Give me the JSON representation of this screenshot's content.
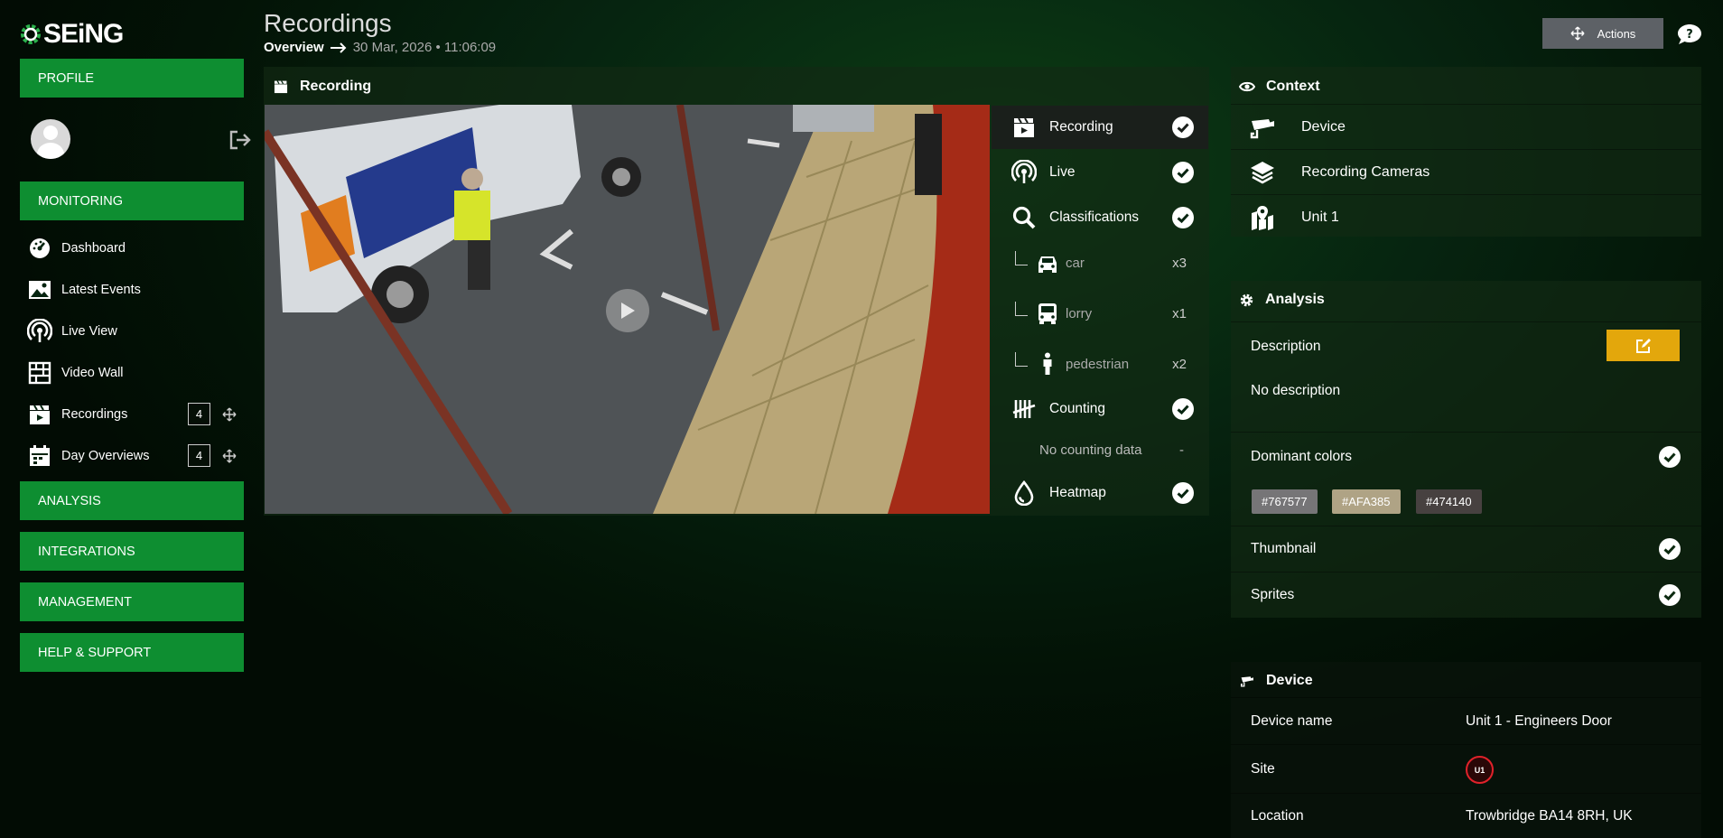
{
  "brand": {
    "logo_text": "SEiNG"
  },
  "sidebar": {
    "sections": {
      "profile": "PROFILE",
      "monitoring": "MONITORING",
      "analysis": "ANALYSIS",
      "integrations": "INTEGRATIONS",
      "management": "MANAGEMENT",
      "help": "HELP & SUPPORT"
    },
    "monitoring_items": [
      {
        "label": "Dashboard",
        "icon": "dashboard-icon"
      },
      {
        "label": "Latest Events",
        "icon": "image-icon"
      },
      {
        "label": "Live View",
        "icon": "live-icon"
      },
      {
        "label": "Video Wall",
        "icon": "video-wall-icon"
      },
      {
        "label": "Recordings",
        "icon": "clapperboard-icon",
        "count": "4"
      },
      {
        "label": "Day Overviews",
        "icon": "calendar-icon",
        "count": "4"
      }
    ]
  },
  "header": {
    "title": "Recordings",
    "breadcrumb_root": "Overview",
    "breadcrumb_date": "30 Mar, 2026 • 11:06:09",
    "actions_label": "Actions"
  },
  "recording_panel": {
    "title": "Recording",
    "features": [
      {
        "label": "Recording",
        "checked": true
      },
      {
        "label": "Live",
        "checked": true
      },
      {
        "label": "Classifications",
        "checked": true
      },
      {
        "label": "Counting",
        "checked": true
      },
      {
        "label": "Heatmap",
        "checked": true
      }
    ],
    "classifications": [
      {
        "label": "car",
        "count": "x3"
      },
      {
        "label": "lorry",
        "count": "x1"
      },
      {
        "label": "pedestrian",
        "count": "x2"
      }
    ],
    "counting_empty": "No counting data",
    "counting_dash": "-"
  },
  "context_panel": {
    "title": "Context",
    "rows": [
      {
        "label": "Device",
        "icon": "camera-icon"
      },
      {
        "label": "Recording Cameras",
        "icon": "layers-icon"
      },
      {
        "label": "Unit 1",
        "icon": "map-marker-icon"
      }
    ]
  },
  "analysis_panel": {
    "title": "Analysis",
    "description_label": "Description",
    "description_value": "No description",
    "dominant_colors_label": "Dominant colors",
    "dominant_colors": [
      "#767577",
      "#AFA385",
      "#474140"
    ],
    "thumbnail_label": "Thumbnail",
    "sprites_label": "Sprites"
  },
  "device_panel": {
    "title": "Device",
    "device_name_label": "Device name",
    "device_name_value": "Unit 1 - Engineers Door",
    "site_label": "Site",
    "site_badge": "U1",
    "location_label": "Location",
    "location_value": "Trowbridge BA14 8RH, UK"
  },
  "colors": {
    "nav_green": "#0e8e31",
    "edit_yellow": "#e3a70c",
    "site_red": "#e0222a"
  }
}
